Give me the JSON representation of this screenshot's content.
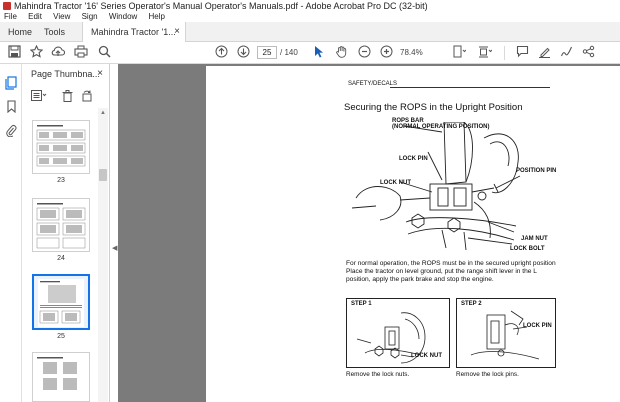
{
  "window": {
    "title": "Mahindra Tractor '16' Series Operator's Manual Operator's Manuals.pdf - Adobe Acrobat Pro DC (32-bit)"
  },
  "menu": [
    "File",
    "Edit",
    "View",
    "Sign",
    "Window",
    "Help"
  ],
  "tabs": {
    "home": "Home",
    "tools": "Tools",
    "document": "Mahindra Tractor '1...",
    "close": "×"
  },
  "toolbar": {
    "current_page": "25",
    "page_total": "/ 140",
    "zoom": "78.4%"
  },
  "thumbnails": {
    "header": "Page Thumbna...",
    "close": "×",
    "pages": [
      {
        "label": "23",
        "selected": false
      },
      {
        "label": "24",
        "selected": false
      },
      {
        "label": "25",
        "selected": true
      },
      {
        "label": "",
        "selected": false
      }
    ]
  },
  "page_content": {
    "section_header": "SAFETY/DECALS",
    "heading": "Securing the ROPS in the Upright Position",
    "diagram_labels": {
      "rops_bar": "ROPS BAR",
      "rops_bar_sub": "(NORMAL OPERATING POSITION)",
      "lock_pin": "LOCK PIN",
      "lock_nut": "LOCK NUT",
      "position_pin": "POSITION PIN",
      "jam_nut": "JAM NUT",
      "lock_bolt": "LOCK BOLT"
    },
    "body_lines": [
      "For normal operation, the ROPS must be in the secured upright position",
      "Place the tractor on level ground, put the range shift lever in the L",
      "position, apply the park brake and stop the engine."
    ],
    "step1": {
      "title": "STEP 1",
      "label": "LOCK NUT",
      "caption": "Remove the lock nuts."
    },
    "step2": {
      "title": "STEP 2",
      "label": "LOCK PIN",
      "caption": "Remove the lock pins."
    }
  }
}
